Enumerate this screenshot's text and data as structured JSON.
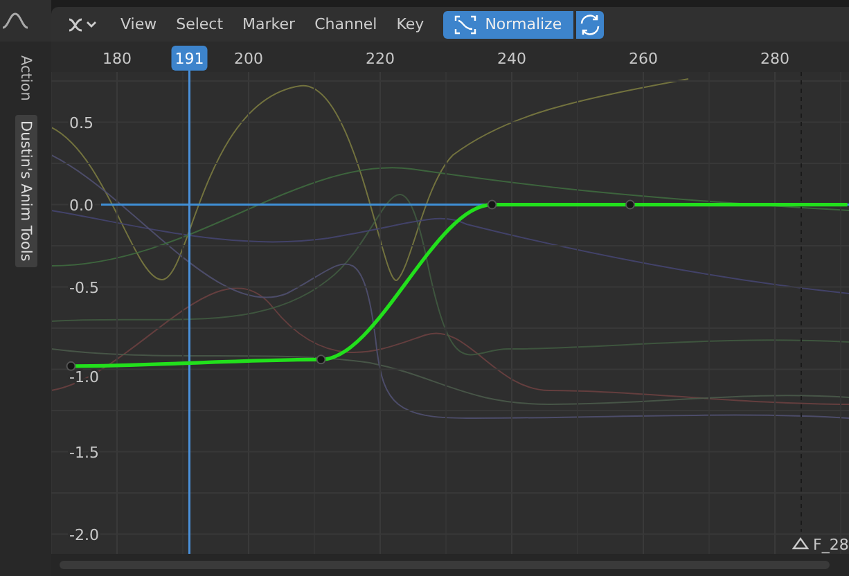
{
  "header": {
    "menus": [
      "View",
      "Select",
      "Marker",
      "Channel",
      "Key"
    ],
    "normalize": {
      "label": "Normalize",
      "on": true
    }
  },
  "sidebar_tabs": [
    {
      "label": "Action",
      "selected": false
    },
    {
      "label": "Dustin's Anim Tools",
      "selected": true
    }
  ],
  "graph": {
    "current_frame": "191",
    "marker": "F_28",
    "chart_data": {
      "type": "line",
      "grid": true,
      "xticks": [
        180,
        200,
        220,
        240,
        260,
        280
      ],
      "yticks": [
        {
          "value": 0.5,
          "label": "0.5"
        },
        {
          "value": 0,
          "label": "0.0"
        },
        {
          "value": -0.5,
          "label": "-0.5"
        },
        {
          "value": -1,
          "label": "-1.0"
        },
        {
          "value": -1.5,
          "label": "-1.5"
        },
        {
          "value": -2,
          "label": "-2.0"
        }
      ],
      "xlim": [
        170,
        291
      ],
      "ylim": [
        -2.25,
        0.99
      ],
      "ref_lines": [
        {
          "axis": "y",
          "value": 0,
          "color": "#3f8fd6"
        },
        {
          "axis": "x",
          "value": 191,
          "color": "#4a90d9"
        },
        {
          "axis": "x",
          "value": 284,
          "color": "#1a1a1a"
        }
      ],
      "series": [
        {
          "color": "#22e01c",
          "marker": "o",
          "x": [
            173,
            211,
            237,
            258,
            291
          ],
          "values": [
            -0.98,
            -0.94,
            0,
            0,
            0
          ]
        }
      ]
    }
  }
}
